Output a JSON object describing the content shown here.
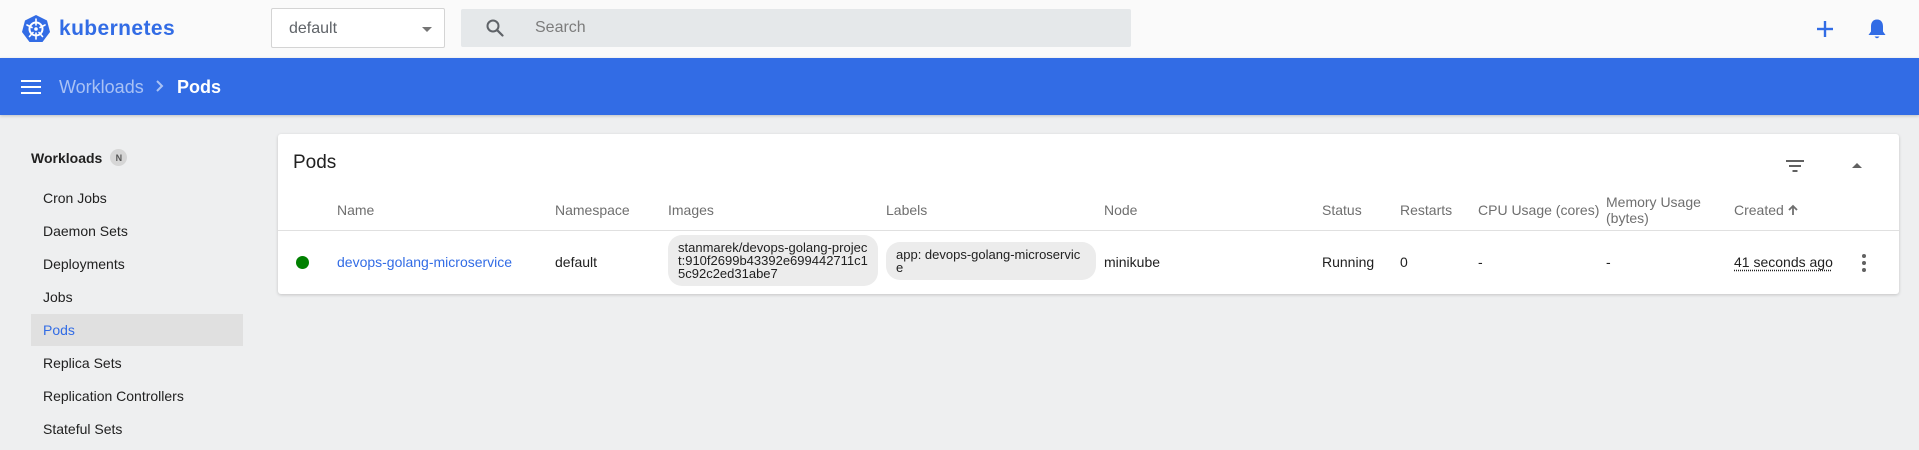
{
  "app": {
    "brand": "kubernetes",
    "accent_color": "#326ce5"
  },
  "toolbar": {
    "namespace": "default",
    "search_placeholder": "Search",
    "create_icon": "plus-icon",
    "notifications_icon": "bell-icon"
  },
  "breadcrumb": {
    "parent": "Workloads",
    "current": "Pods"
  },
  "sidebar": {
    "section": "Workloads",
    "section_badge": "N",
    "items": [
      {
        "label": "Cron Jobs",
        "active": false
      },
      {
        "label": "Daemon Sets",
        "active": false
      },
      {
        "label": "Deployments",
        "active": false
      },
      {
        "label": "Jobs",
        "active": false
      },
      {
        "label": "Pods",
        "active": true
      },
      {
        "label": "Replica Sets",
        "active": false
      },
      {
        "label": "Replication Controllers",
        "active": false
      },
      {
        "label": "Stateful Sets",
        "active": false
      }
    ]
  },
  "pods": {
    "title": "Pods",
    "columns": [
      "Name",
      "Namespace",
      "Images",
      "Labels",
      "Node",
      "Status",
      "Restarts",
      "CPU Usage (cores)",
      "Memory Usage (bytes)",
      "Created"
    ],
    "sort_column": "Created",
    "rows": [
      {
        "status_color": "#008000",
        "name": "devops-golang-microservice",
        "namespace": "default",
        "image": "stanmarek/devops-golang-project:910f2699b43392e699442711c15c92c2ed31abe7",
        "label": "app: devops-golang-microservice",
        "node": "minikube",
        "status": "Running",
        "restarts": "0",
        "cpu": "-",
        "memory": "-",
        "created": "41 seconds ago"
      }
    ]
  }
}
